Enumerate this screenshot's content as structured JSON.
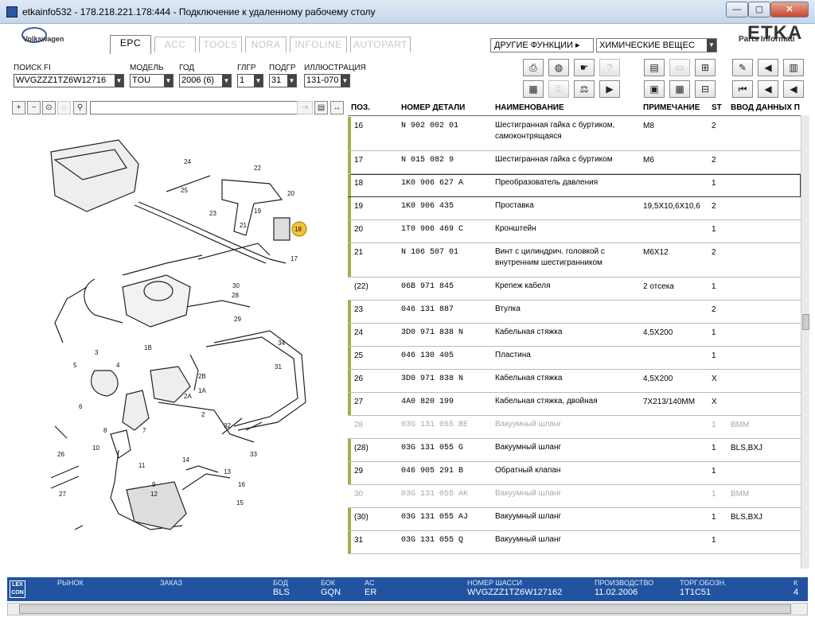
{
  "window": {
    "title": "etkainfo532 - 178.218.221.178:444 - Подключение к удаленному рабочему столу",
    "minimize": "—",
    "maximize": "▢",
    "close": "✕"
  },
  "brand": {
    "make": "Volkswagen",
    "etka_logo": "ETKA",
    "etka_sub": "Parts Informati"
  },
  "tabs": [
    {
      "label": "EPC",
      "active": true
    },
    {
      "label": "ACC",
      "active": false
    },
    {
      "label": "TOOLS",
      "active": false
    },
    {
      "label": "NORA",
      "active": false
    },
    {
      "label": "INFOLINE",
      "active": false
    },
    {
      "label": "AUTOPART",
      "active": false
    }
  ],
  "header_right": {
    "other_functions": "ДРУГИЕ ФУНКЦИИ ▸",
    "chemicals": "ХИМИЧЕСКИЕ ВЕЩЕС"
  },
  "search": {
    "fi_label": "ПОИСК FI",
    "fi_value": "WVGZZZ1TZ6W12716",
    "model_label": "МОДЕЛЬ",
    "model_value": "TOU",
    "year_label": "ГОД",
    "year_value": "2006 (6)",
    "mg_label": "ГЛГР",
    "mg_value": "1",
    "sg_label": "ПОДГР",
    "sg_value": "31",
    "illus_label": "ИЛЛЮСТРАЦИЯ",
    "illus_value": "131-070"
  },
  "table": {
    "headers": {
      "pos": "ПОЗ.",
      "part": "НОМЕР ДЕТАЛИ",
      "name": "НАИМЕНОВАНИЕ",
      "note": "ПРИМЕЧАНИЕ",
      "st": "ST",
      "input": "ВВОД ДАННЫХ П"
    },
    "rows": [
      {
        "pos": "16",
        "part": "N    902 002 01",
        "name": "Шестигранная гайка с буртиком, самоконтрящаяся",
        "note": "M8",
        "st": "2",
        "extra": "",
        "grey": false,
        "mark": true,
        "selected": false,
        "tall": true
      },
      {
        "pos": "17",
        "part": "N    015 082 9",
        "name": "Шестигранная гайка с буртиком",
        "note": "M6",
        "st": "2",
        "extra": "",
        "grey": false,
        "mark": true,
        "selected": false,
        "tall": false
      },
      {
        "pos": "18",
        "part": "1K0 906 627 A",
        "name": "Преобразователь давления",
        "note": "",
        "st": "1",
        "extra": "",
        "grey": false,
        "mark": true,
        "selected": true,
        "tall": false
      },
      {
        "pos": "19",
        "part": "1K0 906 435",
        "name": "Проставка",
        "note": "19,5X10,6X10,6",
        "st": "2",
        "extra": "",
        "grey": false,
        "mark": true,
        "selected": false,
        "tall": false
      },
      {
        "pos": "20",
        "part": "1T0 906 469 C",
        "name": "Кронштейн",
        "note": "",
        "st": "1",
        "extra": "",
        "grey": false,
        "mark": true,
        "selected": false,
        "tall": false
      },
      {
        "pos": "21",
        "part": "N    106 507 01",
        "name": "Винт с цилиндрич. головкой с внутренним шестигранником",
        "note": "M6X12",
        "st": "2",
        "extra": "",
        "grey": false,
        "mark": true,
        "selected": false,
        "tall": true
      },
      {
        "pos": "(22)",
        "part": "06B 971 845",
        "name": "Крепеж кабеля",
        "note": "2 отсека",
        "st": "1",
        "extra": "",
        "grey": false,
        "mark": false,
        "selected": false,
        "tall": false
      },
      {
        "pos": "23",
        "part": "046 131 887",
        "name": "Втулка",
        "note": "",
        "st": "2",
        "extra": "",
        "grey": false,
        "mark": true,
        "selected": false,
        "tall": false
      },
      {
        "pos": "24",
        "part": "3D0 971 838 N",
        "name": "Кабельная стяжка",
        "note": "4,5X200",
        "st": "1",
        "extra": "",
        "grey": false,
        "mark": true,
        "selected": false,
        "tall": false
      },
      {
        "pos": "25",
        "part": "046 130 405",
        "name": "Пластина",
        "note": "",
        "st": "1",
        "extra": "",
        "grey": false,
        "mark": true,
        "selected": false,
        "tall": false
      },
      {
        "pos": "26",
        "part": "3D0 971 838 N",
        "name": "Кабельная стяжка",
        "note": "4,5X200",
        "st": "X",
        "extra": "",
        "grey": false,
        "mark": true,
        "selected": false,
        "tall": false
      },
      {
        "pos": "27",
        "part": "4A0 820 199",
        "name": "Кабельная стяжка, двойная",
        "note": "7X213/140MM",
        "st": "X",
        "extra": "",
        "grey": false,
        "mark": true,
        "selected": false,
        "tall": false
      },
      {
        "pos": "28",
        "part": "03G 131 055 BE",
        "name": "Вакуумный шланг",
        "note": "",
        "st": "1",
        "extra": "BMM",
        "grey": true,
        "mark": false,
        "selected": false,
        "tall": false
      },
      {
        "pos": "(28)",
        "part": "03G 131 055 G",
        "name": "Вакуумный шланг",
        "note": "",
        "st": "1",
        "extra": "BLS,BXJ",
        "grey": false,
        "mark": true,
        "selected": false,
        "tall": false
      },
      {
        "pos": "29",
        "part": "046 905 291 B",
        "name": "Обратный клапан",
        "note": "",
        "st": "1",
        "extra": "",
        "grey": false,
        "mark": true,
        "selected": false,
        "tall": false
      },
      {
        "pos": "30",
        "part": "03G 131 055 AK",
        "name": "Вакуумный шланг",
        "note": "",
        "st": "1",
        "extra": "BMM",
        "grey": true,
        "mark": false,
        "selected": false,
        "tall": false
      },
      {
        "pos": "(30)",
        "part": "03G 131 055 AJ",
        "name": "Вакуумный шланг",
        "note": "",
        "st": "1",
        "extra": "BLS,BXJ",
        "grey": false,
        "mark": true,
        "selected": false,
        "tall": false
      },
      {
        "pos": "31",
        "part": "03G 131 055 Q",
        "name": "Вакуумный шланг",
        "note": "",
        "st": "1",
        "extra": "",
        "grey": false,
        "mark": true,
        "selected": false,
        "tall": false
      }
    ]
  },
  "status": {
    "logo_top": "LEX",
    "logo_bottom": "CON",
    "market_label": "РЫНОК",
    "market_value": "",
    "order_label": "ЗАКАЗ",
    "order_value": "",
    "engine_label": "БОД",
    "engine_value": "BLS",
    "gearbox_label": "БОК",
    "gearbox_value": "GQN",
    "ac_label": "AC",
    "ac_value": "ER",
    "chassis_label": "НОМЕР ШАССИ",
    "chassis_value": "WVGZZZ1TZ6W127162",
    "production_label": "ПРОИЗВОДСТВО",
    "production_value": "11.02.2006",
    "trade_label": "ТОРГ.ОБОЗН.",
    "trade_value": "1T1C51",
    "extra_label": "К",
    "extra_value": "4"
  },
  "diagram": {
    "labels": [
      "24",
      "22",
      "25",
      "20",
      "23",
      "19",
      "21",
      "18",
      "17",
      "30",
      "28",
      "29",
      "34",
      "3",
      "1B",
      "5",
      "4",
      "2B",
      "2A",
      "1A",
      "2",
      "31",
      "6",
      "8",
      "7",
      "32",
      "26",
      "10",
      "33",
      "11",
      "14",
      "13",
      "9",
      "16",
      "15",
      "27",
      "12"
    ],
    "highlight": "18"
  },
  "colors": {
    "status_bar": "#2153a1",
    "row_marker": "#9bb34a",
    "highlight_callout": "#f5c433"
  }
}
